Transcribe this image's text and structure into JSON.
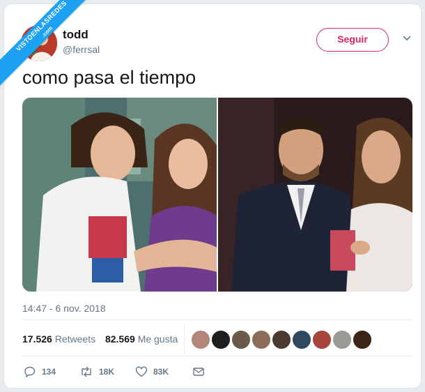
{
  "watermark": {
    "line1": "VISTOENLASREDES",
    "line2": ".com"
  },
  "author": {
    "name": "todd",
    "handle": "@ferrsal"
  },
  "follow_label": "Seguir",
  "tweet": {
    "text": "como pasa el tiempo",
    "timestamp": "14:47 - 6 nov. 2018"
  },
  "stats": {
    "retweets_count": "17.526",
    "retweets_label": "Retweets",
    "likes_count": "82.569",
    "likes_label": "Me gusta"
  },
  "actions": {
    "replies": "134",
    "retweets": "18K",
    "likes": "83K"
  },
  "colors": {
    "accent": "#1da1f2",
    "follow": "#e0245e",
    "muted": "#657786"
  }
}
